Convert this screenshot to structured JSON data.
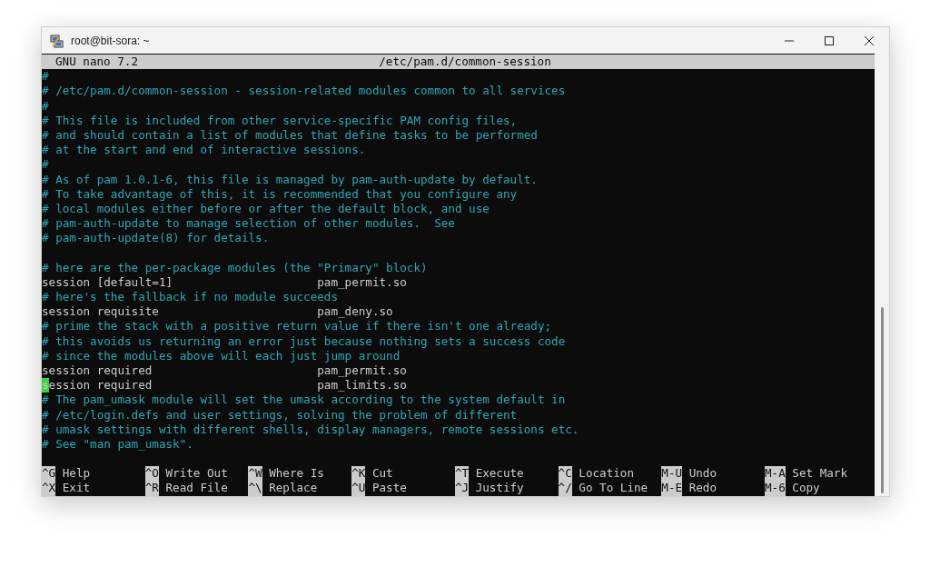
{
  "window": {
    "title": "root@bit-sora: ~"
  },
  "header": {
    "app": "GNU nano 7.2",
    "file": "/etc/pam.d/common-session"
  },
  "lines": [
    {
      "kind": "comment",
      "text": "#"
    },
    {
      "kind": "comment",
      "text": "# /etc/pam.d/common-session - session-related modules common to all services"
    },
    {
      "kind": "comment",
      "text": "#"
    },
    {
      "kind": "comment",
      "text": "# This file is included from other service-specific PAM config files,"
    },
    {
      "kind": "comment",
      "text": "# and should contain a list of modules that define tasks to be performed"
    },
    {
      "kind": "comment",
      "text": "# at the start and end of interactive sessions."
    },
    {
      "kind": "comment",
      "text": "#"
    },
    {
      "kind": "comment",
      "text": "# As of pam 1.0.1-6, this file is managed by pam-auth-update by default."
    },
    {
      "kind": "comment",
      "text": "# To take advantage of this, it is recommended that you configure any"
    },
    {
      "kind": "comment",
      "text": "# local modules either before or after the default block, and use"
    },
    {
      "kind": "comment",
      "text": "# pam-auth-update to manage selection of other modules.  See"
    },
    {
      "kind": "comment",
      "text": "# pam-auth-update(8) for details."
    },
    {
      "kind": "blank"
    },
    {
      "kind": "comment",
      "text": "# here are the per-package modules (the \"Primary\" block)"
    },
    {
      "kind": "code",
      "text": "session [default=1]                     pam_permit.so"
    },
    {
      "kind": "comment",
      "text": "# here's the fallback if no module succeeds"
    },
    {
      "kind": "code",
      "text": "session requisite                       pam_deny.so"
    },
    {
      "kind": "comment",
      "text": "# prime the stack with a positive return value if there isn't one already;"
    },
    {
      "kind": "comment",
      "text": "# this avoids us returning an error just because nothing sets a success code"
    },
    {
      "kind": "comment",
      "text": "# since the modules above will each just jump around"
    },
    {
      "kind": "code",
      "text": "session required                        pam_permit.so"
    },
    {
      "kind": "code",
      "text": "session required                        pam_limits.so",
      "cursor": true
    },
    {
      "kind": "comment",
      "text": "# The pam_umask module will set the umask according to the system default in"
    },
    {
      "kind": "comment",
      "text": "# /etc/login.defs and user settings, solving the problem of different"
    },
    {
      "kind": "comment",
      "text": "# umask settings with different shells, display managers, remote sessions etc."
    },
    {
      "kind": "comment",
      "text": "# See \"man pam_umask\"."
    },
    {
      "kind": "blank"
    }
  ],
  "shortcuts": [
    [
      {
        "key": "^G",
        "label": "Help"
      },
      {
        "key": "^O",
        "label": "Write Out"
      },
      {
        "key": "^W",
        "label": "Where Is"
      },
      {
        "key": "^K",
        "label": "Cut"
      },
      {
        "key": "^T",
        "label": "Execute"
      },
      {
        "key": "^C",
        "label": "Location"
      },
      {
        "key": "M-U",
        "label": "Undo"
      },
      {
        "key": "M-A",
        "label": "Set Mark"
      }
    ],
    [
      {
        "key": "^X",
        "label": "Exit"
      },
      {
        "key": "^R",
        "label": "Read File"
      },
      {
        "key": "^\\",
        "label": "Replace"
      },
      {
        "key": "^U",
        "label": "Paste"
      },
      {
        "key": "^J",
        "label": "Justify"
      },
      {
        "key": "^/",
        "label": "Go To Line"
      },
      {
        "key": "M-E",
        "label": "Redo"
      },
      {
        "key": "M-6",
        "label": "Copy"
      }
    ]
  ]
}
